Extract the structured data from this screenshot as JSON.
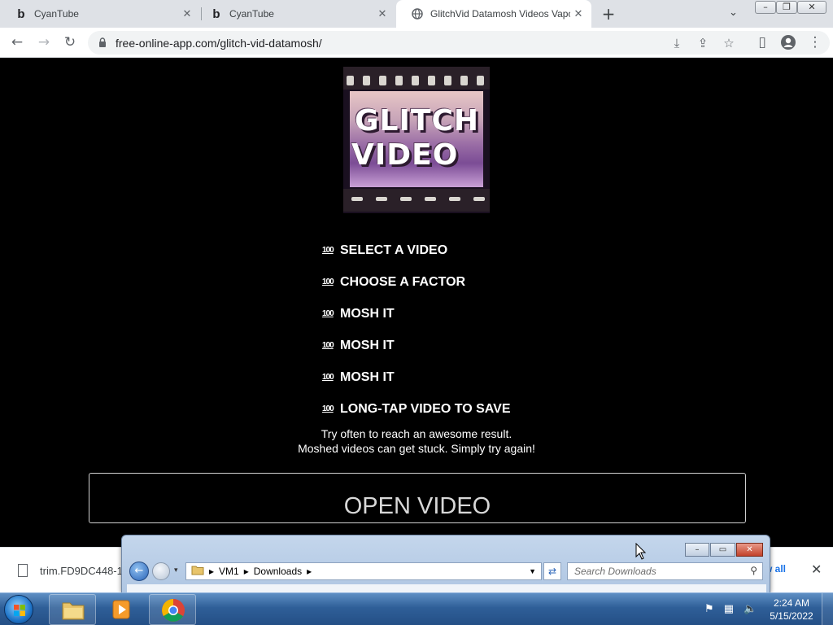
{
  "browser": {
    "tabs": [
      {
        "title": "CyanTube",
        "favicon": "b",
        "active": false
      },
      {
        "title": "CyanTube",
        "favicon": "b",
        "active": false
      },
      {
        "title": "GlitchVid Datamosh Videos Vapor",
        "favicon": "globe-icon",
        "active": true
      }
    ],
    "url": "free-online-app.com/glitch-vid-datamosh/"
  },
  "page": {
    "logo_words": [
      "GLITCH",
      "VIDEO"
    ],
    "step_marker": "100",
    "steps": [
      "SELECT A VIDEO",
      "CHOOSE A FACTOR",
      "MOSH IT",
      "MOSH IT",
      "MOSH IT",
      "LONG-TAP VIDEO TO SAVE"
    ],
    "tip_line_1": "Try often to reach an awesome result.",
    "tip_line_2": "Moshed videos can get stuck. Simply try again!",
    "open_button": "OPEN VIDEO"
  },
  "download_bar": {
    "file_name": "trim.FD9DC448-1",
    "show_all": "w all"
  },
  "explorer": {
    "path": [
      "VM1",
      "Downloads"
    ],
    "search_placeholder": "Search Downloads"
  },
  "taskbar": {
    "time": "2:24 AM",
    "date": "5/15/2022"
  },
  "colors": {
    "page_bg": "#000000",
    "tab_strip": "#dee1e6",
    "link_blue": "#1a73e8",
    "taskbar": "#2f5f98"
  }
}
